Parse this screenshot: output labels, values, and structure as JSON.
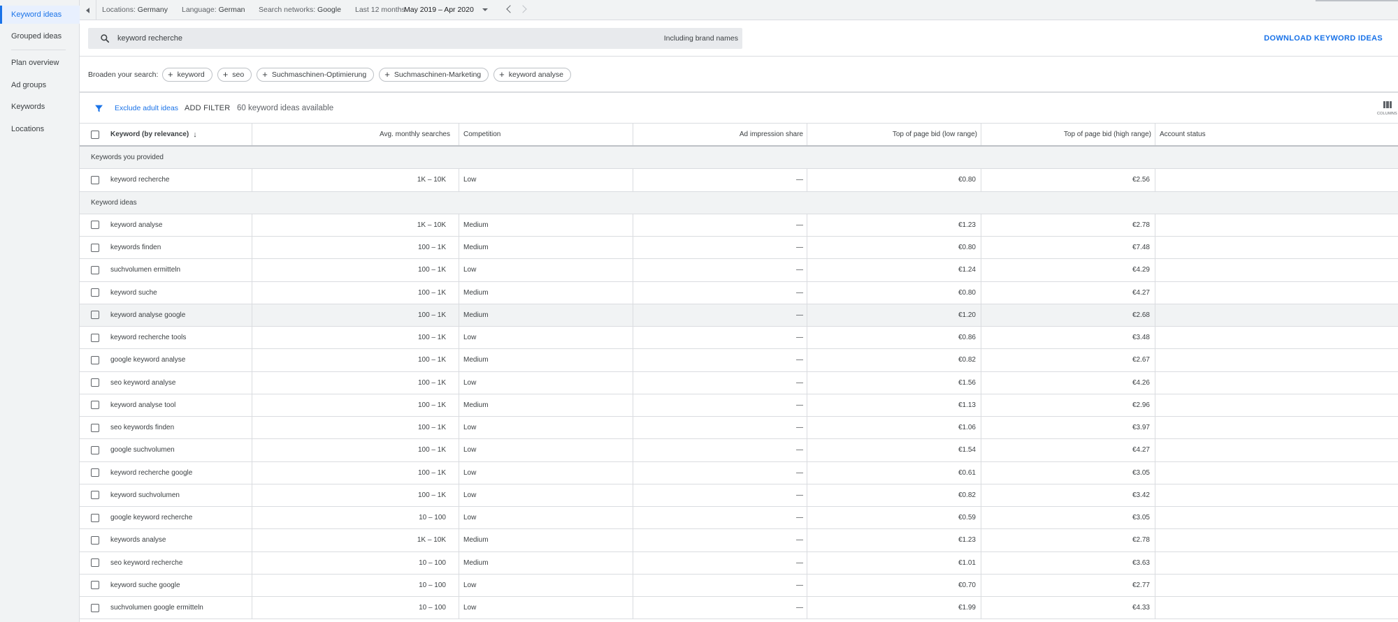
{
  "sidebar": {
    "items": [
      {
        "label": "Keyword ideas",
        "active": true
      },
      {
        "label": "Grouped ideas"
      },
      {
        "label": "Plan overview"
      },
      {
        "label": "Ad groups"
      },
      {
        "label": "Keywords"
      },
      {
        "label": "Locations"
      }
    ]
  },
  "topbar": {
    "locations_label": "Locations:",
    "locations_value": "Germany",
    "language_label": "Language:",
    "language_value": "German",
    "networks_label": "Search networks:",
    "networks_value": "Google",
    "period_label": "Last 12 months",
    "period_value": "May 2019 – Apr 2020"
  },
  "search": {
    "query": "keyword recherche",
    "brand_toggle": "Including brand names",
    "download_label": "DOWNLOAD KEYWORD IDEAS"
  },
  "broaden": {
    "label": "Broaden your search:",
    "chips": [
      "keyword",
      "seo",
      "Suchmaschinen-Optimierung",
      "Suchmaschinen-Marketing",
      "keyword analyse"
    ]
  },
  "filter": {
    "exclude_adult": "Exclude adult ideas",
    "add_filter": "ADD FILTER",
    "count_text": "60 keyword ideas available",
    "columns_label": "COLUMNS"
  },
  "table": {
    "headers": {
      "keyword": "Keyword (by relevance)",
      "avg": "Avg. monthly searches",
      "competition": "Competition",
      "impression": "Ad impression share",
      "bid_low": "Top of page bid (low range)",
      "bid_high": "Top of page bid (high range)",
      "status": "Account status"
    },
    "group_provided": "Keywords you provided",
    "group_ideas": "Keyword ideas",
    "provided": [
      [
        "keyword recherche",
        "1K – 10K",
        "Low",
        "—",
        "€0.80",
        "€2.56"
      ]
    ],
    "ideas": [
      [
        "keyword analyse",
        "1K – 10K",
        "Medium",
        "—",
        "€1.23",
        "€2.78"
      ],
      [
        "keywords finden",
        "100 – 1K",
        "Medium",
        "—",
        "€0.80",
        "€7.48"
      ],
      [
        "suchvolumen ermitteln",
        "100 – 1K",
        "Low",
        "—",
        "€1.24",
        "€4.29"
      ],
      [
        "keyword suche",
        "100 – 1K",
        "Medium",
        "—",
        "€0.80",
        "€4.27"
      ],
      [
        "keyword analyse google",
        "100 – 1K",
        "Medium",
        "—",
        "€1.20",
        "€2.68"
      ],
      [
        "keyword recherche tools",
        "100 – 1K",
        "Low",
        "—",
        "€0.86",
        "€3.48"
      ],
      [
        "google keyword analyse",
        "100 – 1K",
        "Medium",
        "—",
        "€0.82",
        "€2.67"
      ],
      [
        "seo keyword analyse",
        "100 – 1K",
        "Low",
        "—",
        "€1.56",
        "€4.26"
      ],
      [
        "keyword analyse tool",
        "100 – 1K",
        "Medium",
        "—",
        "€1.13",
        "€2.96"
      ],
      [
        "seo keywords finden",
        "100 – 1K",
        "Low",
        "—",
        "€1.06",
        "€3.97"
      ],
      [
        "google suchvolumen",
        "100 – 1K",
        "Low",
        "—",
        "€1.54",
        "€4.27"
      ],
      [
        "keyword recherche google",
        "100 – 1K",
        "Low",
        "—",
        "€0.61",
        "€3.05"
      ],
      [
        "keyword suchvolumen",
        "100 – 1K",
        "Low",
        "—",
        "€0.82",
        "€3.42"
      ],
      [
        "google keyword recherche",
        "10 – 100",
        "Low",
        "—",
        "€0.59",
        "€3.05"
      ],
      [
        "keywords analyse",
        "1K – 10K",
        "Medium",
        "—",
        "€1.23",
        "€2.78"
      ],
      [
        "seo keyword recherche",
        "10 – 100",
        "Medium",
        "—",
        "€1.01",
        "€3.63"
      ],
      [
        "keyword suche google",
        "10 – 100",
        "Low",
        "—",
        "€0.70",
        "€2.77"
      ],
      [
        "suchvolumen google ermitteln",
        "10 – 100",
        "Low",
        "—",
        "€1.99",
        "€4.33"
      ]
    ]
  },
  "colors": {
    "accent": "#1a73e8",
    "sidebar_bg": "#f1f3f4",
    "divider": "#dadce0"
  }
}
